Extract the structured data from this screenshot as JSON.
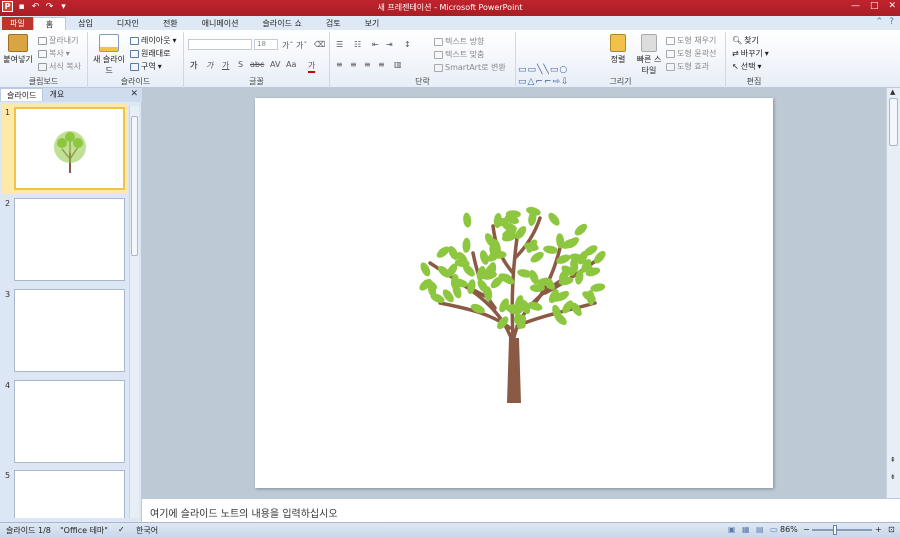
{
  "app": {
    "title": "새 프레젠테이션 - Microsoft PowerPoint",
    "accent": "#c0242d"
  },
  "qat": {
    "save_icon": "save-icon",
    "undo_icon": "undo-icon",
    "redo_icon": "redo-icon"
  },
  "tabs": [
    {
      "label": "파일"
    },
    {
      "label": "홈"
    },
    {
      "label": "삽입"
    },
    {
      "label": "디자인"
    },
    {
      "label": "전환"
    },
    {
      "label": "애니메이션"
    },
    {
      "label": "슬라이드 쇼"
    },
    {
      "label": "검토"
    },
    {
      "label": "보기"
    }
  ],
  "ribbon": {
    "clipboard": {
      "label": "클립보드",
      "paste": "붙여넣기",
      "cut": "잘라내기",
      "copy": "복사",
      "format_painter": "서식 복사"
    },
    "slides": {
      "label": "슬라이드",
      "new_slide": "새 슬라이드",
      "layout": "레이아웃",
      "reset": "원래대로",
      "section": "구역"
    },
    "font": {
      "label": "글꼴",
      "font_name": "",
      "font_size": "18"
    },
    "paragraph": {
      "label": "단락",
      "text_direction": "텍스트 방향",
      "align_text": "텍스트 맞춤",
      "smartart": "SmartArt로 변환"
    },
    "drawing": {
      "label": "그리기",
      "arrange": "정렬",
      "quick_styles": "빠른 스타일",
      "shape_fill": "도형 채우기",
      "shape_outline": "도형 윤곽선",
      "shape_effects": "도형 효과"
    },
    "editing": {
      "label": "편집",
      "find": "찾기",
      "replace": "바꾸기",
      "select": "선택"
    }
  },
  "panel": {
    "tab_slides": "슬라이드",
    "tab_outline": "개요",
    "slide_numbers": [
      "1",
      "2",
      "3",
      "4",
      "5"
    ]
  },
  "notes": {
    "placeholder": "여기에 슬라이드 노트의 내용을 입력하십시오"
  },
  "status": {
    "slide": "슬라이드 1/8",
    "theme": "\"Office 테마\"",
    "language": "한국어",
    "zoom": "86%"
  },
  "colors": {
    "leaf": "#8dc63f",
    "trunk": "#8b5a44",
    "selection": "#f0c24a"
  }
}
